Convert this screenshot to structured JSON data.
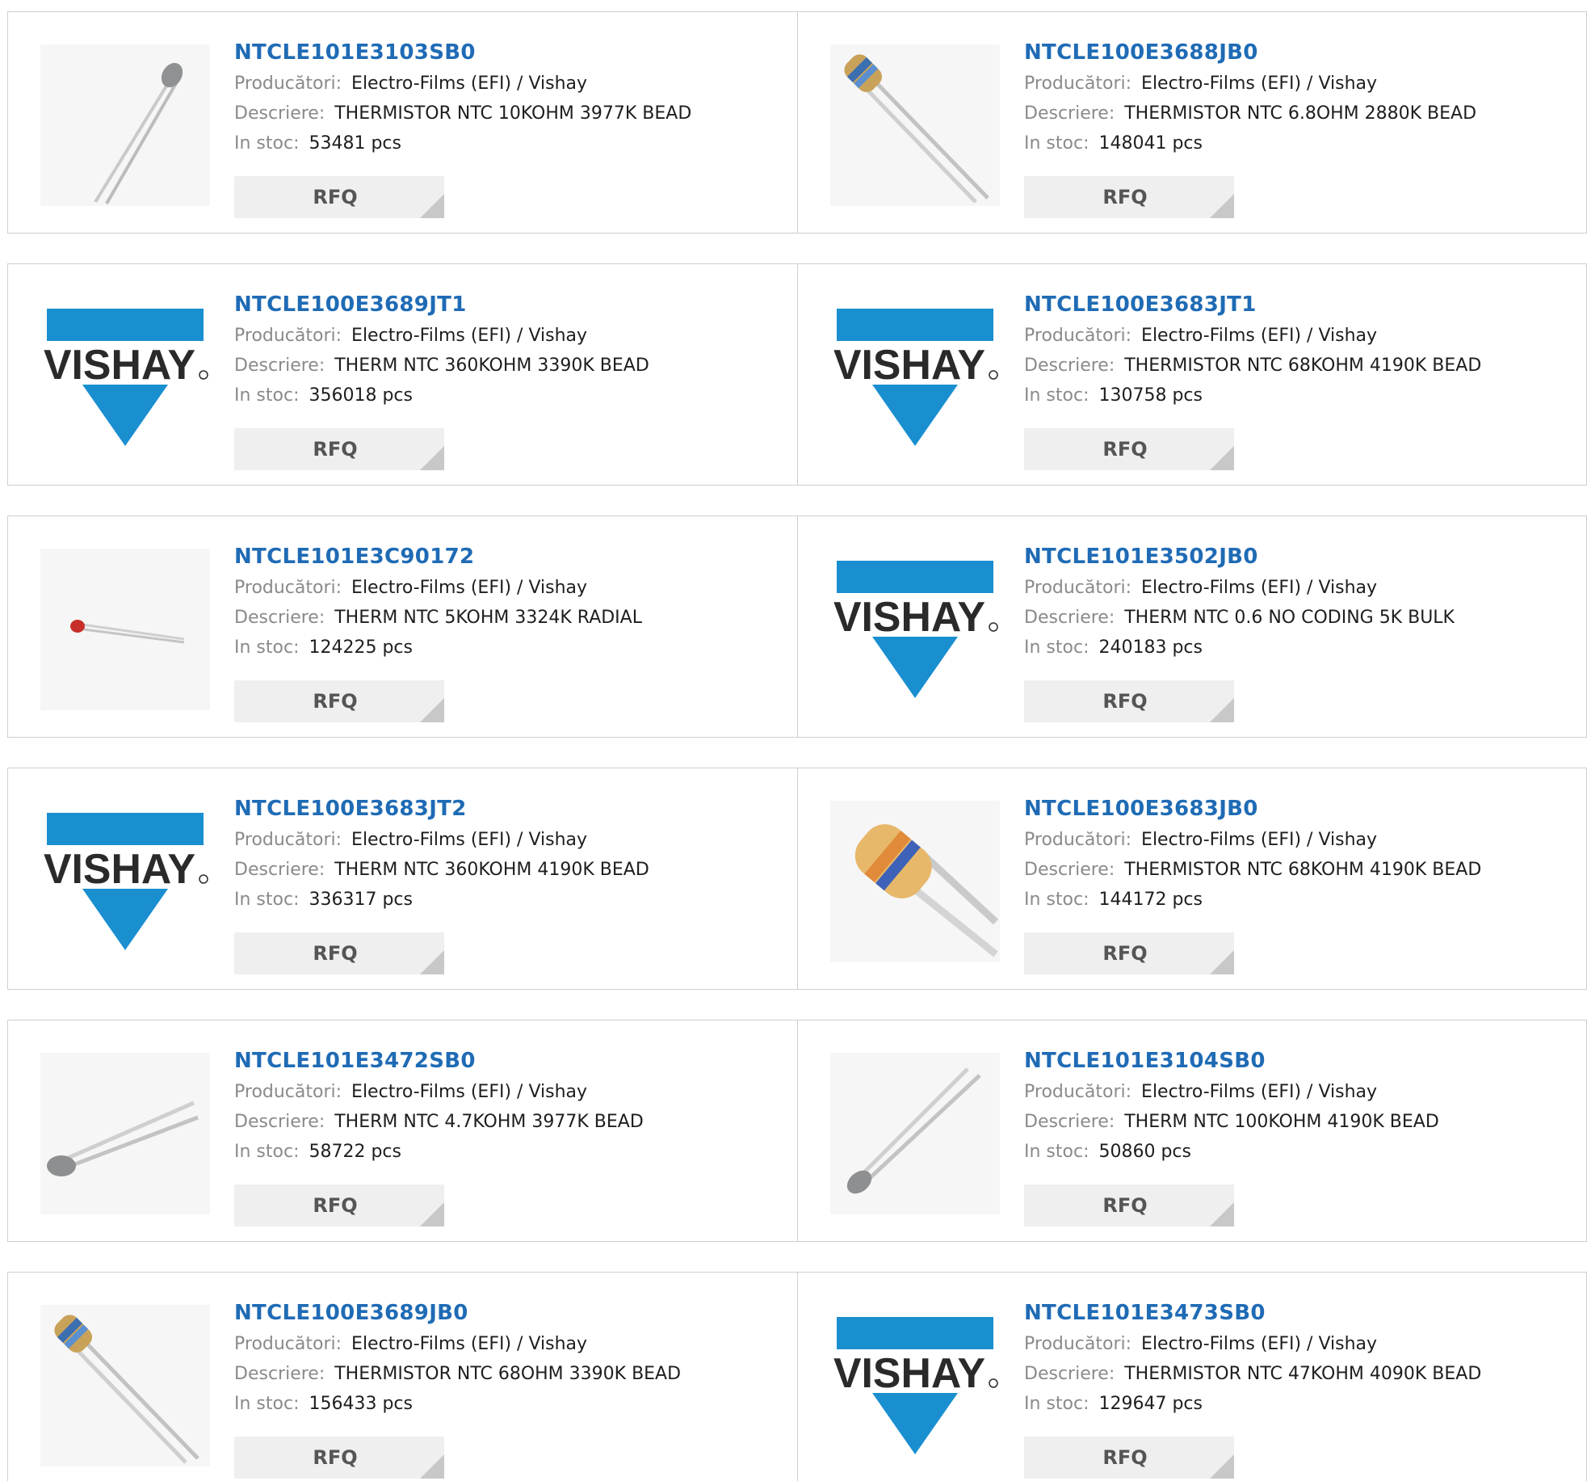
{
  "labels": {
    "manufacturer": "Producători:",
    "description": "Descriere:",
    "stock": "In stoc:",
    "rfq": "RFQ"
  },
  "logo_text": "VISHAY",
  "brand_color": "#1a8fd0",
  "link_color": "#1f6bb5",
  "products": [
    {
      "name": "NTCLE101E3103SB0",
      "manufacturer": "Electro-Films (EFI) / Vishay",
      "description": "THERMISTOR NTC 10KOHM 3977K BEAD",
      "stock": "53481 pcs",
      "image": "gray-bead-thermistor-icon"
    },
    {
      "name": "NTCLE100E3688JB0",
      "manufacturer": "Electro-Films (EFI) / Vishay",
      "description": "THERMISTOR NTC 6.8OHM 2880K BEAD",
      "stock": "148041 pcs",
      "image": "banded-bead-thermistor-icon"
    },
    {
      "name": "NTCLE100E3689JT1",
      "manufacturer": "Electro-Films (EFI) / Vishay",
      "description": "THERM NTC 360KOHM 3390K BEAD",
      "stock": "356018 pcs",
      "image": "vishay-logo"
    },
    {
      "name": "NTCLE100E3683JT1",
      "manufacturer": "Electro-Films (EFI) / Vishay",
      "description": "THERMISTOR NTC 68KOHM 4190K BEAD",
      "stock": "130758 pcs",
      "image": "vishay-logo"
    },
    {
      "name": "NTCLE101E3C90172",
      "manufacturer": "Electro-Films (EFI) / Vishay",
      "description": "THERM NTC 5KOHM 3324K RADIAL",
      "stock": "124225 pcs",
      "image": "red-bead-thermistor-icon"
    },
    {
      "name": "NTCLE101E3502JB0",
      "manufacturer": "Electro-Films (EFI) / Vishay",
      "description": "THERM NTC 0.6 NO CODING 5K BULK",
      "stock": "240183 pcs",
      "image": "vishay-logo"
    },
    {
      "name": "NTCLE100E3683JT2",
      "manufacturer": "Electro-Films (EFI) / Vishay",
      "description": "THERM NTC 360KOHM 4190K BEAD",
      "stock": "336317 pcs",
      "image": "vishay-logo"
    },
    {
      "name": "NTCLE100E3683JB0",
      "manufacturer": "Electro-Films (EFI) / Vishay",
      "description": "THERMISTOR NTC 68KOHM 4190K BEAD",
      "stock": "144172 pcs",
      "image": "banded-bead-closeup-icon"
    },
    {
      "name": "NTCLE101E3472SB0",
      "manufacturer": "Electro-Films (EFI) / Vishay",
      "description": "THERM NTC 4.7KOHM 3977K BEAD",
      "stock": "58722 pcs",
      "image": "gray-bead-left-thermistor-icon"
    },
    {
      "name": "NTCLE101E3104SB0",
      "manufacturer": "Electro-Films (EFI) / Vishay",
      "description": "THERM NTC 100KOHM 4190K BEAD",
      "stock": "50860 pcs",
      "image": "gray-bead-diagonal-thermistor-icon"
    },
    {
      "name": "NTCLE100E3689JB0",
      "manufacturer": "Electro-Films (EFI) / Vishay",
      "description": "THERMISTOR NTC 68OHM 3390K BEAD",
      "stock": "156433 pcs",
      "image": "banded-bead-thermistor-icon"
    },
    {
      "name": "NTCLE101E3473SB0",
      "manufacturer": "Electro-Films (EFI) / Vishay",
      "description": "THERMISTOR NTC 47KOHM 4090K BEAD",
      "stock": "129647 pcs",
      "image": "vishay-logo"
    }
  ]
}
